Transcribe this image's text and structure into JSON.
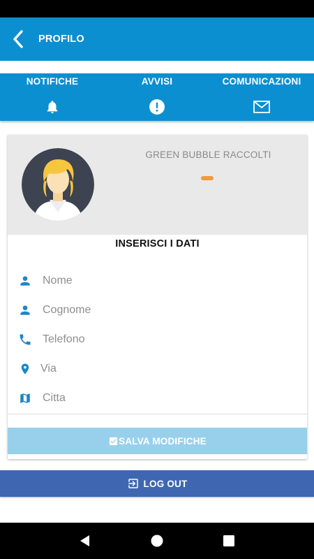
{
  "app_bar": {
    "title": "PROFILO",
    "back_icon": "chevron-left-icon"
  },
  "tabs": [
    {
      "label": "NOTIFICHE",
      "icon": "bell-icon"
    },
    {
      "label": "AVVISI",
      "icon": "alert-circle-icon"
    },
    {
      "label": "COMUNICAZIONI",
      "icon": "mail-icon"
    }
  ],
  "profile": {
    "stat_label": "GREEN BUBBLE RACCOLTI",
    "stat_value": "",
    "avatar_icon": "user-avatar-icon"
  },
  "form": {
    "title": "INSERISCI I DATI",
    "fields": [
      {
        "placeholder": "Nome",
        "value": "",
        "icon": "person-icon"
      },
      {
        "placeholder": "Cognome",
        "value": "",
        "icon": "person-icon"
      },
      {
        "placeholder": "Telefono",
        "value": "",
        "icon": "phone-icon"
      },
      {
        "placeholder": "Via",
        "value": "",
        "icon": "location-pin-icon"
      },
      {
        "placeholder": "Citta",
        "value": "",
        "icon": "map-icon"
      }
    ],
    "save_label": "SALVA MODIFICHE"
  },
  "logout": {
    "label": "LOG OUT",
    "icon": "exit-icon"
  },
  "colors": {
    "primary": "#0b8fd1",
    "save_button": "#98d0ec",
    "logout_button": "#3f67b1",
    "accent_orange": "#f29a3c",
    "icon_blue": "#1b86c9"
  }
}
